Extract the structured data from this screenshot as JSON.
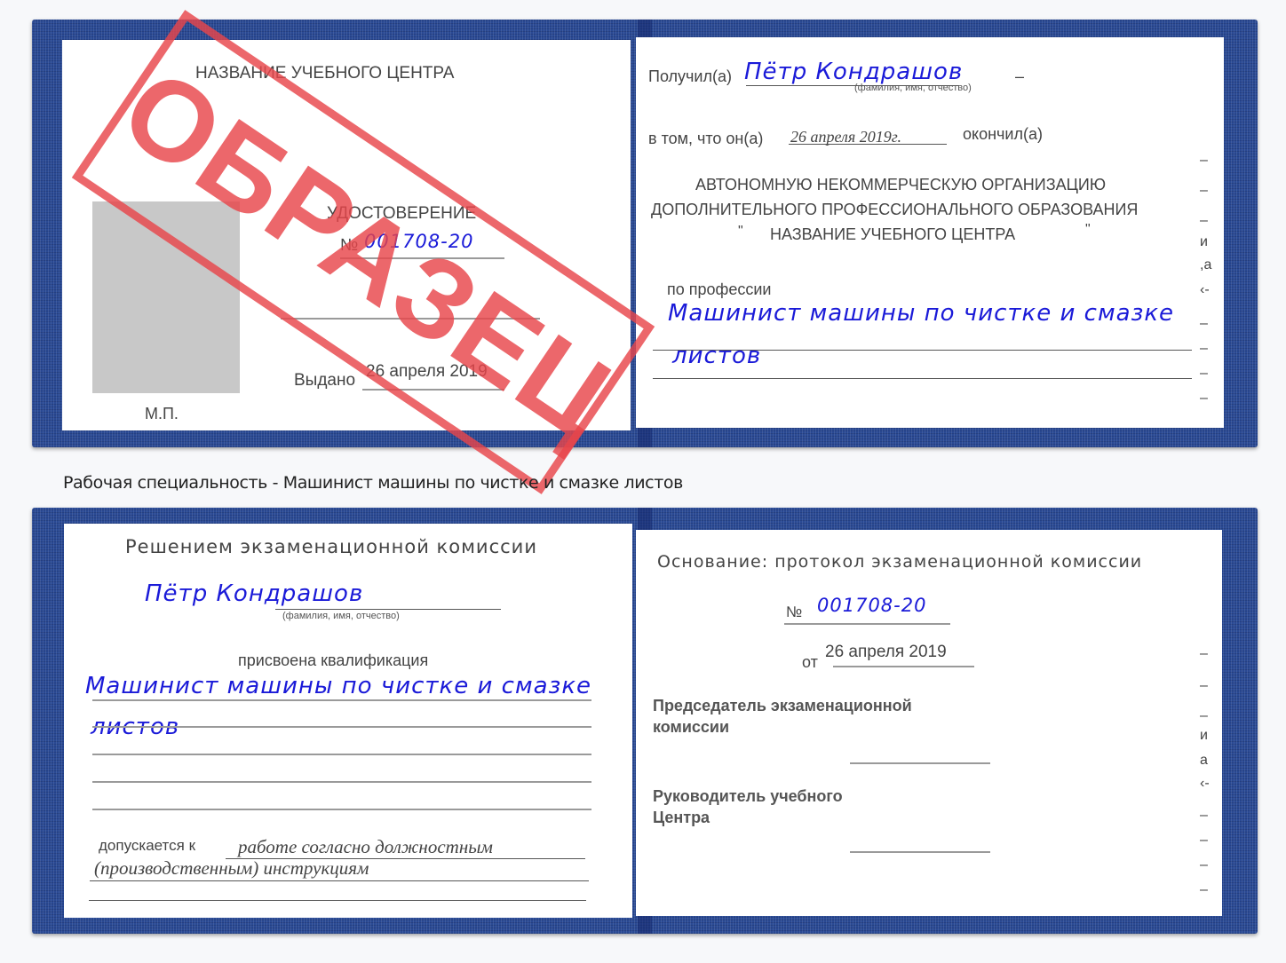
{
  "colors": {
    "cover_blue": "#2a4a94",
    "handwriting_blue": "#1a1ad8",
    "stamp_red": "#e8464b",
    "photo_placeholder": "#c8c8c8"
  },
  "stamp": {
    "text": "ОБРАЗЕЦ"
  },
  "top_spread": {
    "left_page": {
      "org_name": "НАЗВАНИЕ УЧЕБНОГО ЦЕНТРА",
      "doc_title": "УДОСТОВЕРЕНИЕ",
      "number_prefix": "№",
      "number_value": "001708-20",
      "issued_label": "Выдано",
      "issued_date": "26 апреля 2019",
      "seal_label": "М.П."
    },
    "right_page": {
      "received_label": "Получил(а)",
      "recipient_name": "Пётр Кондрашов",
      "name_hint": "(фамилия, имя, отчество)",
      "that_label": "в том, что он(а)",
      "completion_date": "26 апреля 2019г.",
      "completed_label": "окончил(а)",
      "org_line1": "АВТОНОМНУЮ НЕКОММЕРЧЕСКУЮ ОРГАНИЗАЦИЮ",
      "org_line2": "ДОПОЛНИТЕЛЬНОГО ПРОФЕССИОНАЛЬНОГО ОБРАЗОВАНИЯ",
      "org_line3_open_quote": "\"",
      "org_line3": "НАЗВАНИЕ УЧЕБНОГО ЦЕНТРА",
      "org_line3_close_quote": "\"",
      "profession_label": "по профессии",
      "profession_line1": "Машинист машины по чистке и смазке",
      "profession_line2": "листов",
      "edge_marks": [
        "–",
        "–",
        "–",
        "и",
        ",а",
        "‹-",
        "–",
        "–",
        "–",
        "–"
      ]
    }
  },
  "caption": "Рабочая специальность - Машинист машины по чистке и смазке листов",
  "bottom_spread": {
    "left_page": {
      "decision_heading": "Решением экзаменационной комиссии",
      "person_name": "Пётр Кондрашов",
      "name_hint": "(фамилия, имя, отчество)",
      "qualification_label": "присвоена квалификация",
      "qualification_line1": "Машинист машины по чистке и смазке",
      "qualification_line2": "листов",
      "admitted_label": "допускается к",
      "admitted_text_line1": "работе согласно должностным",
      "admitted_text_line2": "(производственным) инструкциям"
    },
    "right_page": {
      "basis_heading": "Основание: протокол экзаменационной комиссии",
      "number_prefix": "№",
      "number_value": "001708-20",
      "date_prefix": "от",
      "date_value": "26 апреля 2019",
      "chairman_line1": "Председатель экзаменационной",
      "chairman_line2": "комиссии",
      "head_line1": "Руководитель учебного",
      "head_line2": "Центра",
      "edge_marks": [
        "–",
        "–",
        "–",
        "и",
        "а",
        "‹-",
        "–",
        "–",
        "–",
        "–"
      ]
    }
  }
}
